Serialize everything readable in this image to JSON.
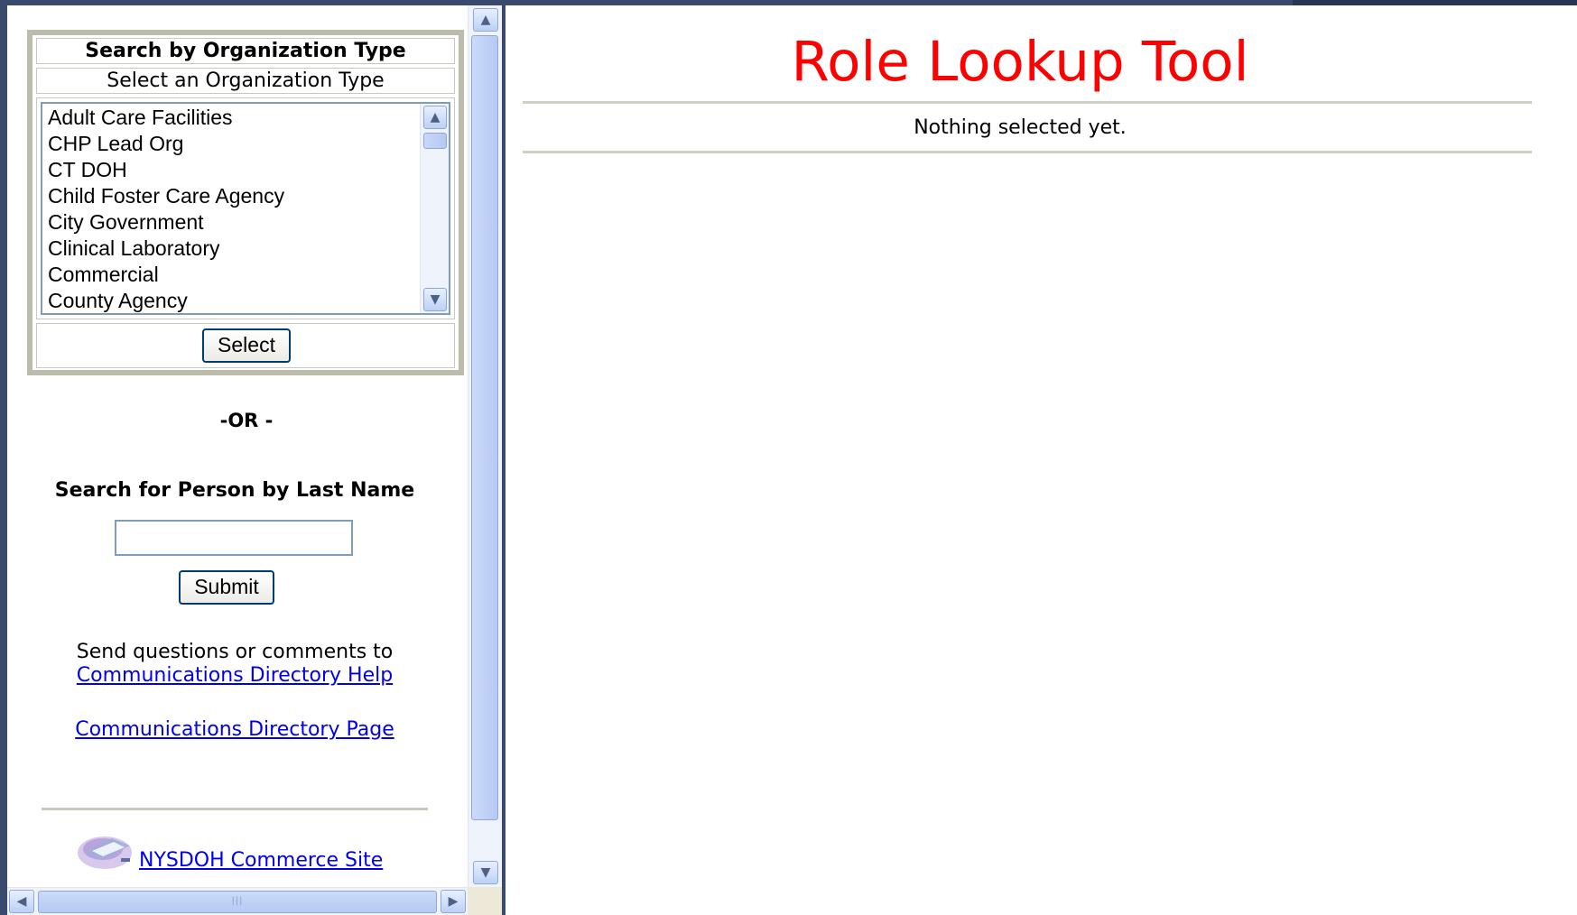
{
  "org_search": {
    "title": "Search by Organization Type",
    "subtitle": "Select an Organization Type",
    "options": [
      "Adult Care Facilities",
      "CHP Lead Org",
      "CT DOH",
      "Child Foster Care Agency",
      "City Government",
      "Clinical Laboratory",
      "Commercial",
      "County Agency"
    ],
    "select_label": "Select"
  },
  "or_label": "-OR -",
  "person_search": {
    "title": "Search for Person by Last Name",
    "last_name_value": "",
    "submit_label": "Submit"
  },
  "help": {
    "text": "Send questions or comments to",
    "help_link": "Communications Directory Help",
    "directory_link": "Communications Directory Page"
  },
  "commerce_link": " NYSDOH Commerce Site",
  "main": {
    "title": "Role Lookup Tool",
    "status": "Nothing selected yet."
  }
}
